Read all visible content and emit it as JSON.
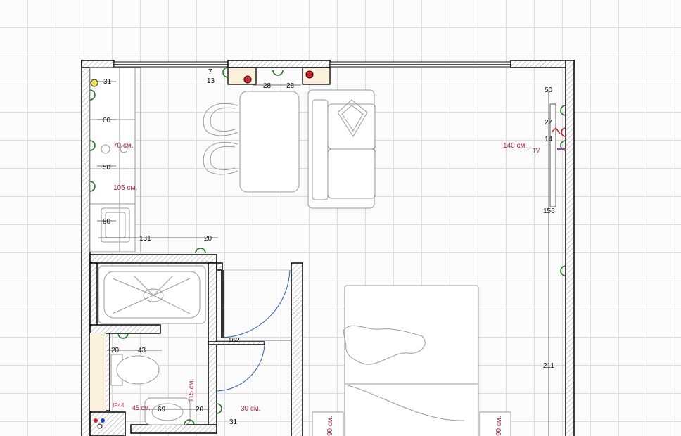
{
  "plan": {
    "dims": {
      "d31_top": "31",
      "d7": "7",
      "d13": "13",
      "d28_a": "28",
      "d28_b": "28",
      "d50_right": "50",
      "d60": "60",
      "d50_left": "50",
      "d27": "27",
      "d14": "14",
      "d80": "80",
      "d131": "131",
      "d20_top": "20",
      "d156": "156",
      "d162": "162",
      "d20_wc": "20",
      "d43": "43",
      "d211": "211",
      "d69": "69",
      "d20_bottom": "20",
      "d31_bottom": "31"
    },
    "notes": {
      "n70": "70 см.",
      "n105": "105 см.",
      "n140": "140 см.",
      "tv": "TV",
      "n115": "115 см.",
      "ip44": "IP44",
      "n45": "45 см.",
      "n30": "30 см.",
      "n90_a": "90 см.",
      "n90_b": "90 см."
    },
    "colors": {
      "wall_outline": "#111111",
      "socket_green": "#1f7a1f",
      "socket_red": "#d61f26",
      "annotation_red": "#b0283a",
      "door_arc_blue": "#2b5fc7",
      "lamp_yellow": "#f2e14c",
      "furniture_grey": "#9a9a9a"
    }
  }
}
